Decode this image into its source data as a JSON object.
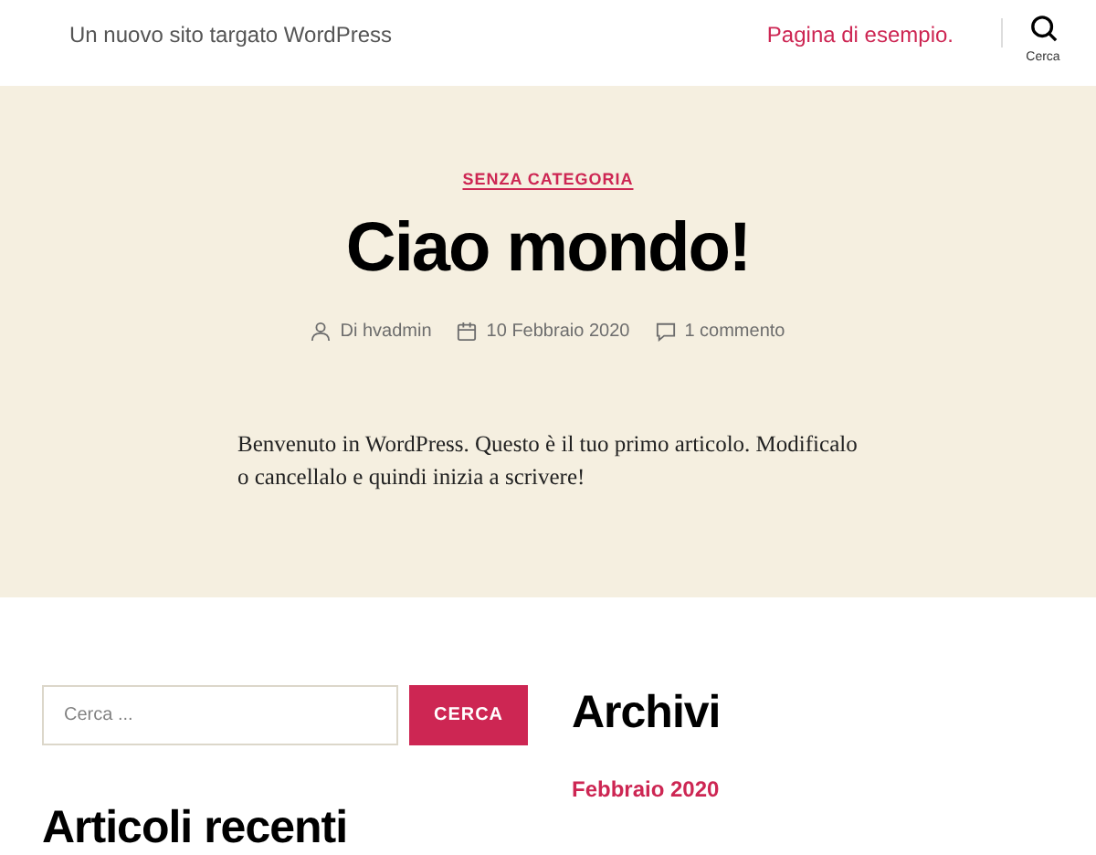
{
  "header": {
    "site_title": "Un nuovo sito targato WordPress",
    "nav_link": "Pagina di esempio.",
    "search_label": "Cerca"
  },
  "post": {
    "category": "SENZA CATEGORIA",
    "title": "Ciao mondo!",
    "author": "Di hvadmin",
    "date": "10 Febbraio 2020",
    "comments": "1 commento",
    "body": "Benvenuto in WordPress. Questo è il tuo primo articolo. Modificalo o cancellalo e quindi inizia a scrivere!"
  },
  "widgets": {
    "search": {
      "placeholder": "Cerca ...",
      "button": "CERCA"
    },
    "recent_title": "Articoli recenti",
    "archive_title": "Archivi",
    "archive_links": [
      "Febbraio 2020"
    ]
  }
}
